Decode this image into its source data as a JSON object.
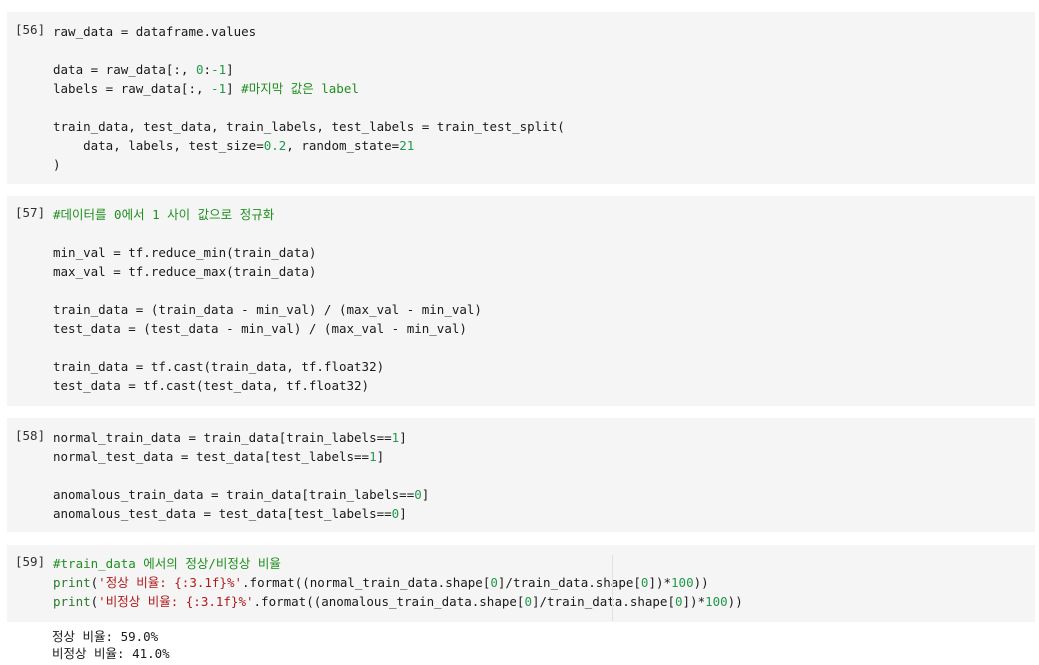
{
  "cells": [
    {
      "prompt": "[56]",
      "lines": [
        [
          {
            "t": "raw_data = dataframe.values",
            "c": ""
          }
        ],
        [],
        [
          {
            "t": "data = raw_data[:, ",
            "c": ""
          },
          {
            "t": "0",
            "c": "num"
          },
          {
            "t": ":",
            "c": ""
          },
          {
            "t": "-1",
            "c": "num"
          },
          {
            "t": "]",
            "c": ""
          }
        ],
        [
          {
            "t": "labels = raw_data[:, ",
            "c": ""
          },
          {
            "t": "-1",
            "c": "num"
          },
          {
            "t": "] ",
            "c": ""
          },
          {
            "t": "#마지막 값은 label",
            "c": "cm"
          }
        ],
        [],
        [
          {
            "t": "train_data, test_data, train_labels, test_labels = train_test_split(",
            "c": ""
          }
        ],
        [
          {
            "t": "    data, labels, test_size=",
            "c": ""
          },
          {
            "t": "0.2",
            "c": "num"
          },
          {
            "t": ", random_state=",
            "c": ""
          },
          {
            "t": "21",
            "c": "num"
          }
        ],
        [
          {
            "t": ")",
            "c": ""
          }
        ]
      ]
    },
    {
      "prompt": "[57]",
      "lines": [
        [
          {
            "t": "#데이터를 0에서 1 사이 값으로 정규화",
            "c": "cm"
          }
        ],
        [],
        [
          {
            "t": "min_val = tf.reduce_min(train_data)",
            "c": ""
          }
        ],
        [
          {
            "t": "max_val = tf.reduce_max(train_data)",
            "c": ""
          }
        ],
        [],
        [
          {
            "t": "train_data = (train_data - min_val) / (max_val - min_val)",
            "c": ""
          }
        ],
        [
          {
            "t": "test_data = (test_data - min_val) / (max_val - min_val)",
            "c": ""
          }
        ],
        [],
        [
          {
            "t": "train_data = tf.cast(train_data, tf.float32)",
            "c": ""
          }
        ],
        [
          {
            "t": "test_data = tf.cast(test_data, tf.float32)",
            "c": ""
          }
        ]
      ]
    },
    {
      "prompt": "[58]",
      "lines": [
        [
          {
            "t": "normal_train_data = train_data[train_labels==",
            "c": ""
          },
          {
            "t": "1",
            "c": "num"
          },
          {
            "t": "]",
            "c": ""
          }
        ],
        [
          {
            "t": "normal_test_data = test_data[test_labels==",
            "c": ""
          },
          {
            "t": "1",
            "c": "num"
          },
          {
            "t": "]",
            "c": ""
          }
        ],
        [],
        [
          {
            "t": "anomalous_train_data = train_data[train_labels==",
            "c": ""
          },
          {
            "t": "0",
            "c": "num"
          },
          {
            "t": "]",
            "c": ""
          }
        ],
        [
          {
            "t": "anomalous_test_data = test_data[test_labels==",
            "c": ""
          },
          {
            "t": "0",
            "c": "num"
          },
          {
            "t": "]",
            "c": ""
          }
        ]
      ]
    },
    {
      "prompt": "[59]",
      "lines": [
        [
          {
            "t": "#train_data 에서의 정상/비정상 비율",
            "c": "cm"
          }
        ],
        [
          {
            "t": "print",
            "c": "fn"
          },
          {
            "t": "(",
            "c": ""
          },
          {
            "t": "'정상 비율: {:3.1f}%'",
            "c": "str"
          },
          {
            "t": ".format((normal_train_data.shape[",
            "c": ""
          },
          {
            "t": "0",
            "c": "num"
          },
          {
            "t": "]/train_data.shape[",
            "c": ""
          },
          {
            "t": "0",
            "c": "num"
          },
          {
            "t": "])*",
            "c": ""
          },
          {
            "t": "100",
            "c": "num"
          },
          {
            "t": "))",
            "c": ""
          }
        ],
        [
          {
            "t": "print",
            "c": "fn"
          },
          {
            "t": "(",
            "c": ""
          },
          {
            "t": "'비정상 비율: {:3.1f}%'",
            "c": "str"
          },
          {
            "t": ".format((anomalous_train_data.shape[",
            "c": ""
          },
          {
            "t": "0",
            "c": "num"
          },
          {
            "t": "]/train_data.shape[",
            "c": ""
          },
          {
            "t": "0",
            "c": "num"
          },
          {
            "t": "])*",
            "c": ""
          },
          {
            "t": "100",
            "c": "num"
          },
          {
            "t": "))",
            "c": ""
          }
        ]
      ]
    }
  ],
  "output": {
    "lines": [
      "정상 비율: 59.0%",
      "비정상 비율: 41.0%"
    ]
  }
}
